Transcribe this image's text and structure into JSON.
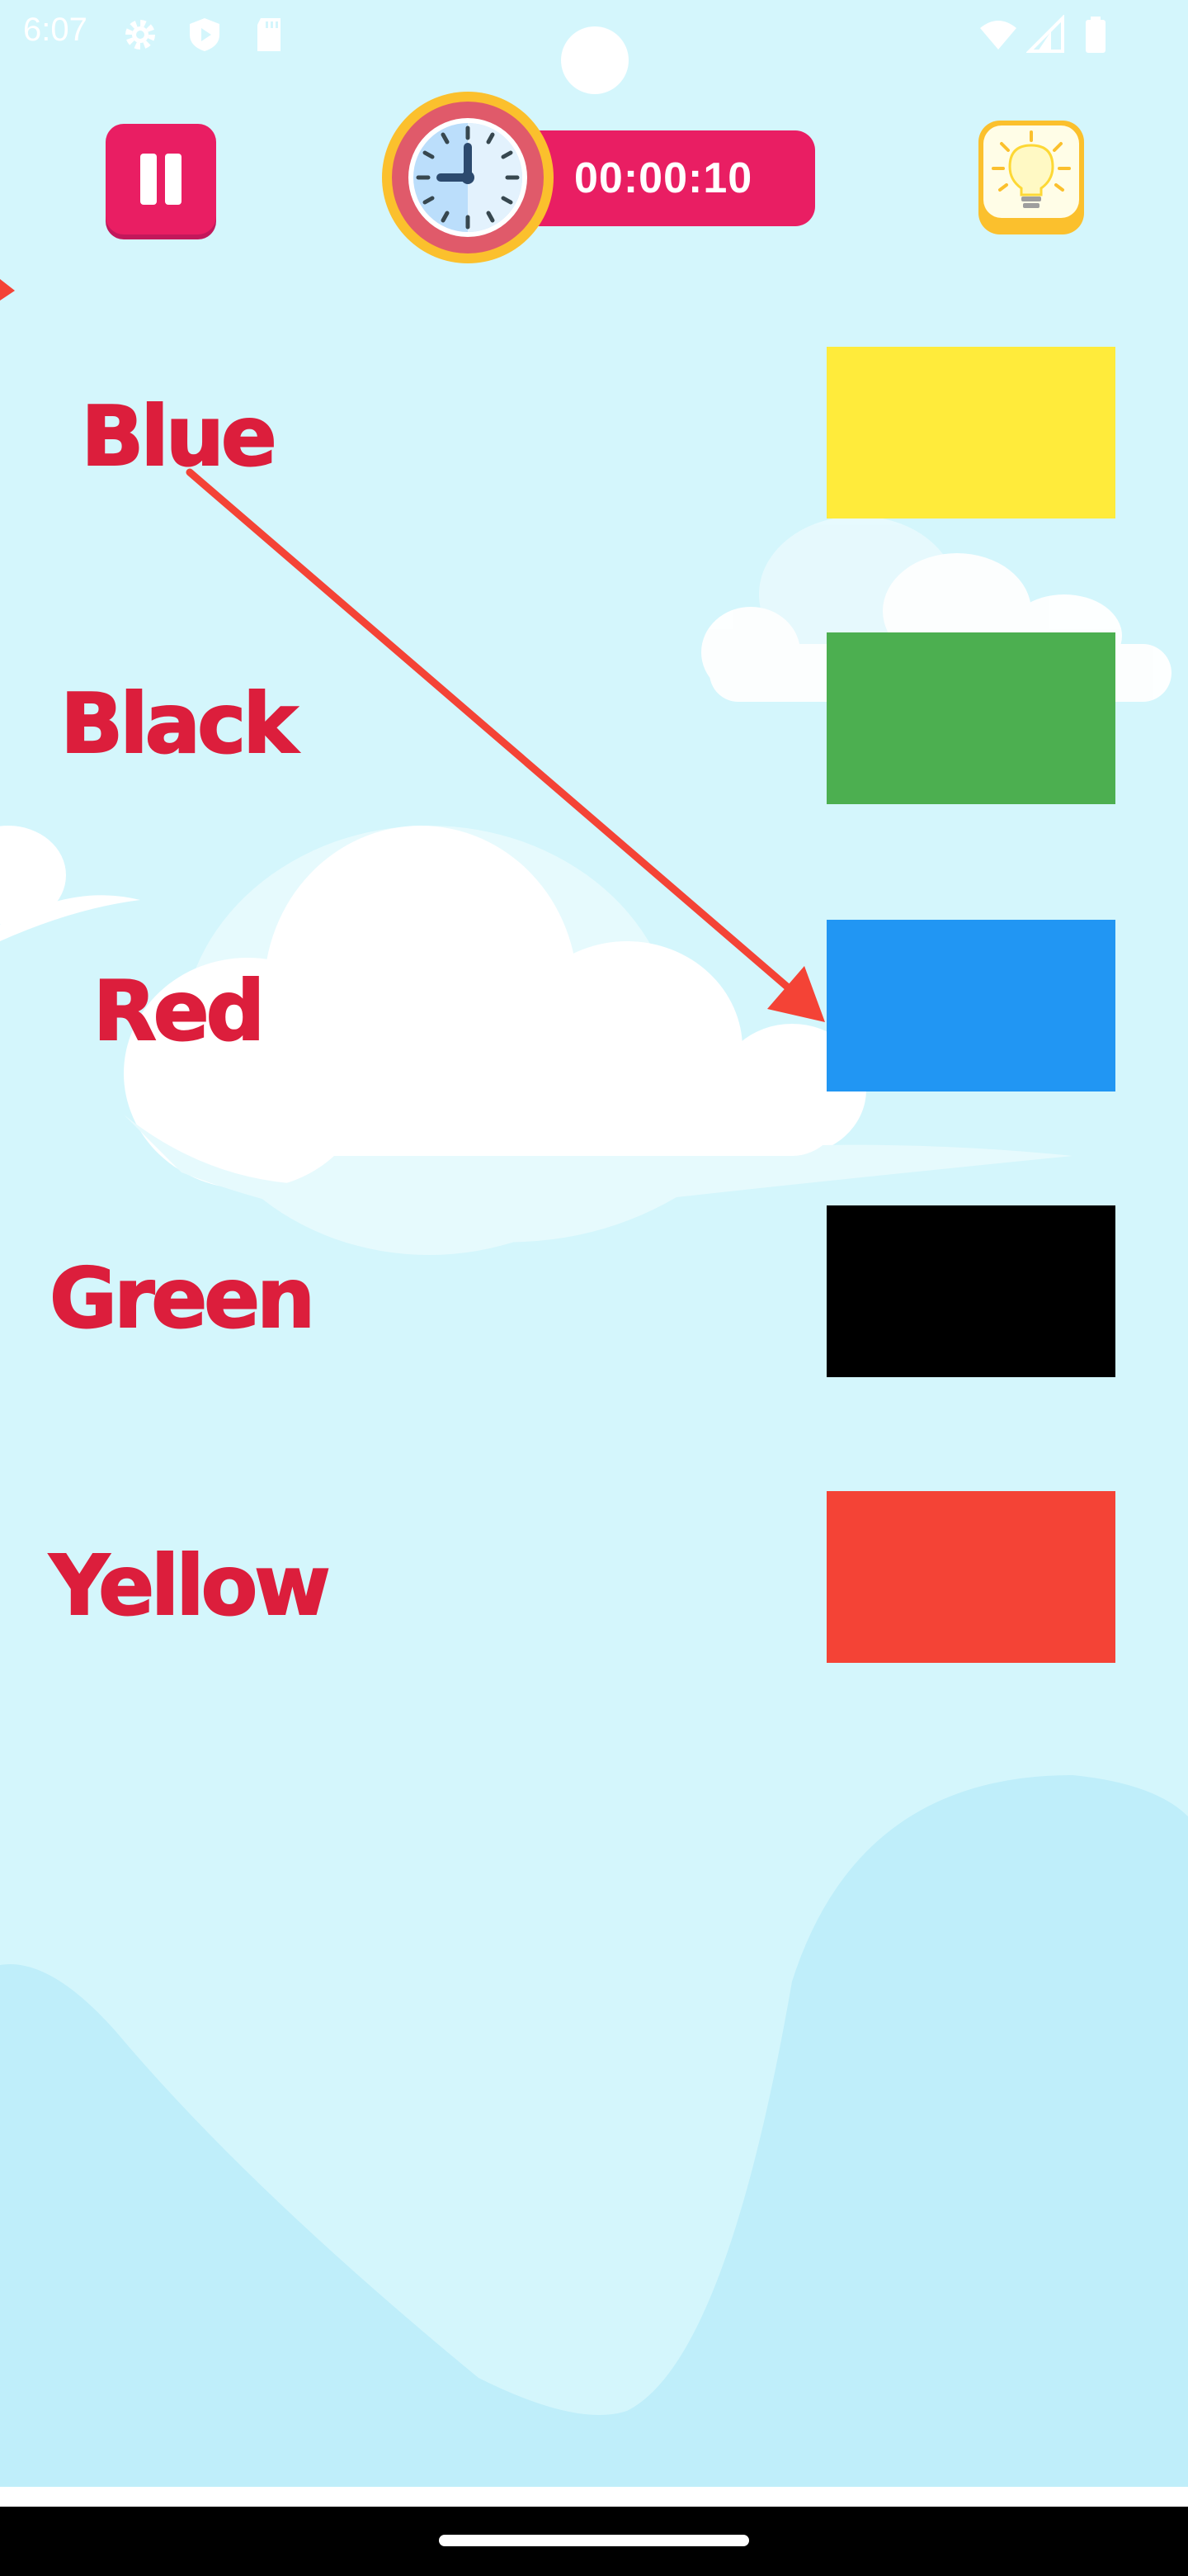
{
  "status_bar": {
    "time": "6:07",
    "icons": [
      "settings-icon",
      "shield-icon",
      "sd-card-icon",
      "wifi-icon",
      "cell-signal-icon",
      "battery-icon"
    ]
  },
  "controls": {
    "pause_icon": "pause-icon",
    "timer": "00:00:10",
    "timer_icon": "clock-icon",
    "hint_icon": "lightbulb-icon"
  },
  "words": [
    {
      "label": "Blue"
    },
    {
      "label": "Black"
    },
    {
      "label": "Red"
    },
    {
      "label": "Green"
    },
    {
      "label": "Yellow"
    }
  ],
  "swatches": [
    {
      "color": "#ffeb3b"
    },
    {
      "color": "#4caf50"
    },
    {
      "color": "#2196f3"
    },
    {
      "color": "#000000"
    },
    {
      "color": "#f44336"
    }
  ],
  "connection": {
    "from_word": "Blue",
    "to_swatch_color": "#2196f3",
    "line_color": "#f44336"
  },
  "colors": {
    "background": "#d4f6fc",
    "accent_pink": "#e91e63",
    "word_red": "#dc1e3c",
    "hill": "#bfeefa"
  }
}
